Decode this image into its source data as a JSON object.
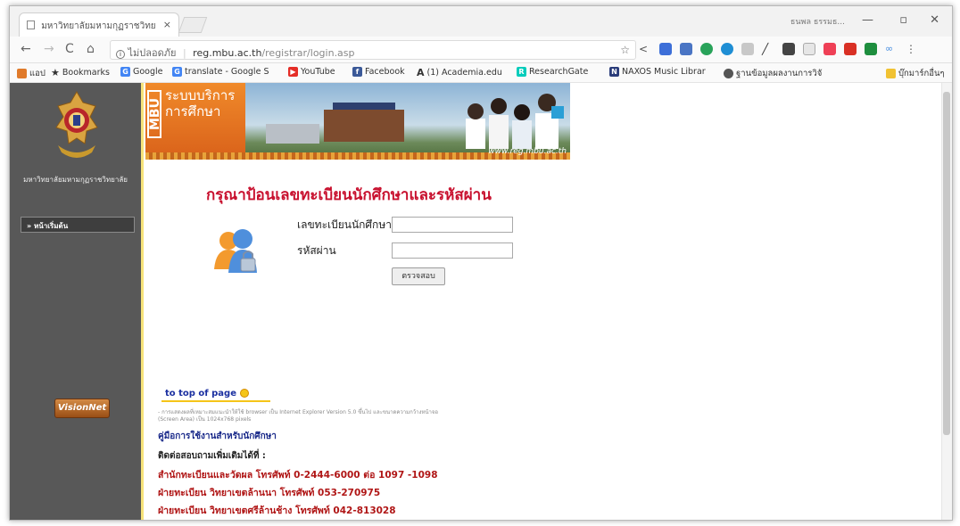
{
  "browser": {
    "tab_title": "มหาวิทยาลัยมหามกุฏราชวิทย",
    "tab_close": "×",
    "window_user": "ธนพล ธรรมธ...",
    "minimize": "—",
    "restore": "▫",
    "close": "✕",
    "nav": {
      "back": "←",
      "forward": "→",
      "reload": "C",
      "home": "⌂"
    },
    "address": {
      "security_label": "ไม่ปลอดภัย",
      "host": "reg.mbu.ac.th",
      "path": "/registrar/login.asp"
    },
    "bookmarks": [
      {
        "label": "แอป",
        "icon": "apps-icon",
        "color": "#e07a2a"
      },
      {
        "label": "Bookmarks",
        "icon": "star-icon",
        "color": "#333333"
      },
      {
        "label": "Google",
        "icon": "google-icon",
        "color": "#4285f4"
      },
      {
        "label": "translate - Google S",
        "icon": "google-icon",
        "color": "#4285f4"
      },
      {
        "label": "YouTube",
        "icon": "youtube-icon",
        "color": "#e52d27"
      },
      {
        "label": "Facebook",
        "icon": "facebook-icon",
        "color": "#3b5998"
      },
      {
        "label": "(1) Academia.edu",
        "icon": "academia-icon",
        "color": "#222222"
      },
      {
        "label": "ResearchGate",
        "icon": "researchgate-icon",
        "color": "#00ccbb"
      },
      {
        "label": "NAXOS Music Librar",
        "icon": "naxos-icon",
        "color": "#2a3c7a"
      },
      {
        "label": "ฐานข้อมูลผลงานการวิจั",
        "icon": "database-icon",
        "color": "#555555"
      },
      {
        "label": "บุ๊กมาร์กอื่นๆ",
        "icon": "folder-icon",
        "color": "#f1c232"
      }
    ]
  },
  "sidebar": {
    "university_name": "มหาวิทยาลัยมหามกุฏราชวิทยาลัย",
    "menu_item": "» หน้าเริ่มต้น",
    "visionnet_label": "VisionNet"
  },
  "banner": {
    "mbu": "MBU",
    "line1": "ระบบบริการ",
    "line2": "การศึกษา",
    "url": "www.reg.mbu.ac.th"
  },
  "login": {
    "heading": "กรุณาป้อนเลขทะเบียนนักศึกษาและรหัสผ่าน",
    "student_id_label": "เลขทะเบียนนักศึกษา",
    "password_label": "รหัสผ่าน",
    "student_id_value": "",
    "password_value": "",
    "submit_label": "ตรวจสอบ"
  },
  "footer": {
    "to_top": "to top of page",
    "note": "- การแสดงผลที่เหมาะสมแนะนำให้ใช้ browser เป็น Internet Explorer Version 5.0 ขึ้นไป และขนาดความกว้างหน้าจอ (Screen Area) เป็น 1024x768 pixels",
    "manual": "คู่มือการใช้งานสำหรับนักศึกษา",
    "contact_heading": "ติดต่อสอบถามเพิ่มเติมได้ที่ :",
    "contacts": [
      "สำนักทะเบียนและวัดผล โทรศัพท์ 0-2444-6000 ต่อ 1097 -1098",
      "ฝ่ายทะเบียน วิทยาเขตล้านนา โทรศัพท์ 053-270975",
      "ฝ่ายทะเบียน วิทยาเขตศรีล้านช้าง โทรศัพท์ 042-813028"
    ]
  },
  "colors": {
    "heading_red": "#c8102e",
    "sidebar_gray": "#585858",
    "banner_orange": "#e8751f",
    "link_blue": "#1a2a8a"
  }
}
